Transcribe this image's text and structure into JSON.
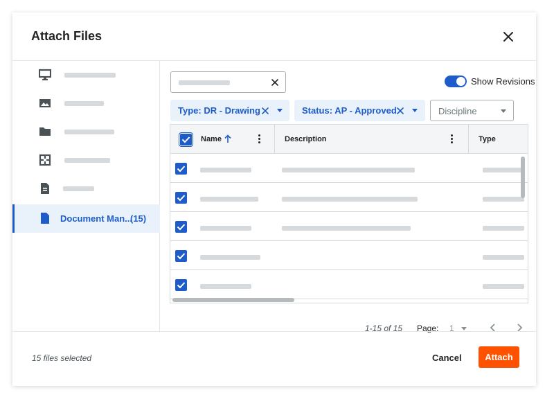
{
  "dialog": {
    "title": "Attach Files"
  },
  "sidebar": {
    "items": [
      {
        "icon": "desktop-icon",
        "label": ""
      },
      {
        "icon": "image-icon",
        "label": ""
      },
      {
        "icon": "folder-icon",
        "label": ""
      },
      {
        "icon": "drawing-icon",
        "label": ""
      },
      {
        "icon": "document-icon",
        "label": ""
      },
      {
        "icon": "document-icon",
        "label": "Document Man...",
        "count": "(15)",
        "active": true
      }
    ]
  },
  "search": {
    "value": ""
  },
  "revisions": {
    "label": "Show Revisions",
    "on": true
  },
  "filters": [
    {
      "label": "Type: DR - Drawing"
    },
    {
      "label": "Status: AP - Approved"
    }
  ],
  "discipline": {
    "placeholder": "Discipline"
  },
  "table": {
    "columns": [
      {
        "label": "Name",
        "sort": "ascending"
      },
      {
        "label": "Description"
      },
      {
        "label": "Type"
      }
    ],
    "row_count_visible": 5
  },
  "pager": {
    "range": "1-15 of 15",
    "label": "Page:",
    "page": "1"
  },
  "footer": {
    "selected": "15 files selected",
    "cancel_label": "Cancel",
    "attach_label": "Attach",
    "attach_color": "#ff5200"
  },
  "colors": {
    "accent": "#1d5cc9",
    "chip_bg": "#e9f1fb"
  }
}
